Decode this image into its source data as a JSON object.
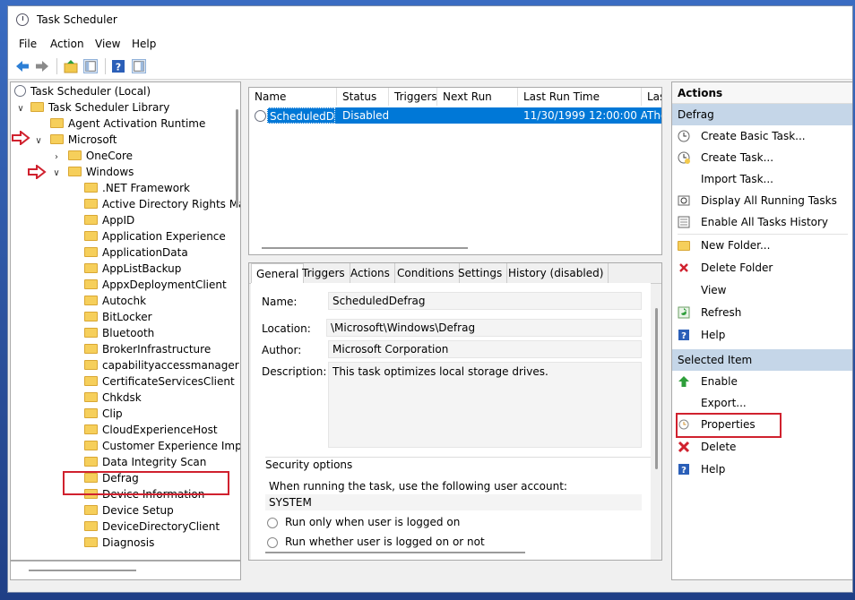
{
  "window": {
    "title": "Task Scheduler"
  },
  "menu": [
    "File",
    "Action",
    "View",
    "Help"
  ],
  "tree": {
    "root": "Task Scheduler (Local)",
    "library": "Task Scheduler Library",
    "agent": "Agent Activation Runtime",
    "microsoft": "Microsoft",
    "onecore": "OneCore",
    "windows": "Windows",
    "folders": [
      ".NET Framework",
      "Active Directory Rights Ma",
      "AppID",
      "Application Experience",
      "ApplicationData",
      "AppListBackup",
      "AppxDeploymentClient",
      "Autochk",
      "BitLocker",
      "Bluetooth",
      "BrokerInfrastructure",
      "capabilityaccessmanager",
      "CertificateServicesClient",
      "Chkdsk",
      "Clip",
      "CloudExperienceHost",
      "Customer Experience Imp",
      "Data Integrity Scan",
      "Defrag",
      "Device Information",
      "Device Setup",
      "DeviceDirectoryClient",
      "Diagnosis"
    ]
  },
  "tasklist": {
    "columns": [
      "Name",
      "Status",
      "Triggers",
      "Next Run Time",
      "Last Run Time",
      "Las"
    ],
    "row": {
      "name": "ScheduledD...",
      "status": "Disabled",
      "triggers": "",
      "next_run": "",
      "last_run": "11/30/1999 12:00:00 AM",
      "last_result": "The"
    }
  },
  "details": {
    "tabs": [
      "General",
      "Triggers",
      "Actions",
      "Conditions",
      "Settings",
      "History (disabled)"
    ],
    "active_tab": "General",
    "name_label": "Name:",
    "name_value": "ScheduledDefrag",
    "location_label": "Location:",
    "location_value": "\\Microsoft\\Windows\\Defrag",
    "author_label": "Author:",
    "author_value": "Microsoft Corporation",
    "description_label": "Description:",
    "description_value": "This task optimizes local storage drives.",
    "security_title": "Security options",
    "account_prompt": "When running the task, use the following user account:",
    "account_value": "SYSTEM",
    "radio1": "Run only when user is logged on",
    "radio2": "Run whether user is logged on or not"
  },
  "actions": {
    "header": "Actions",
    "section1": "Defrag",
    "items1": [
      "Create Basic Task...",
      "Create Task...",
      "Import Task...",
      "Display All Running Tasks",
      "Enable All Tasks History",
      "New Folder...",
      "Delete Folder",
      "View",
      "Refresh",
      "Help"
    ],
    "section2": "Selected Item",
    "items2": [
      "Enable",
      "Export...",
      "Properties",
      "Delete",
      "Help"
    ]
  },
  "colors": {
    "selection": "#0078d7",
    "section_header": "#c5d6e8",
    "highlight_box": "#d0212e"
  }
}
